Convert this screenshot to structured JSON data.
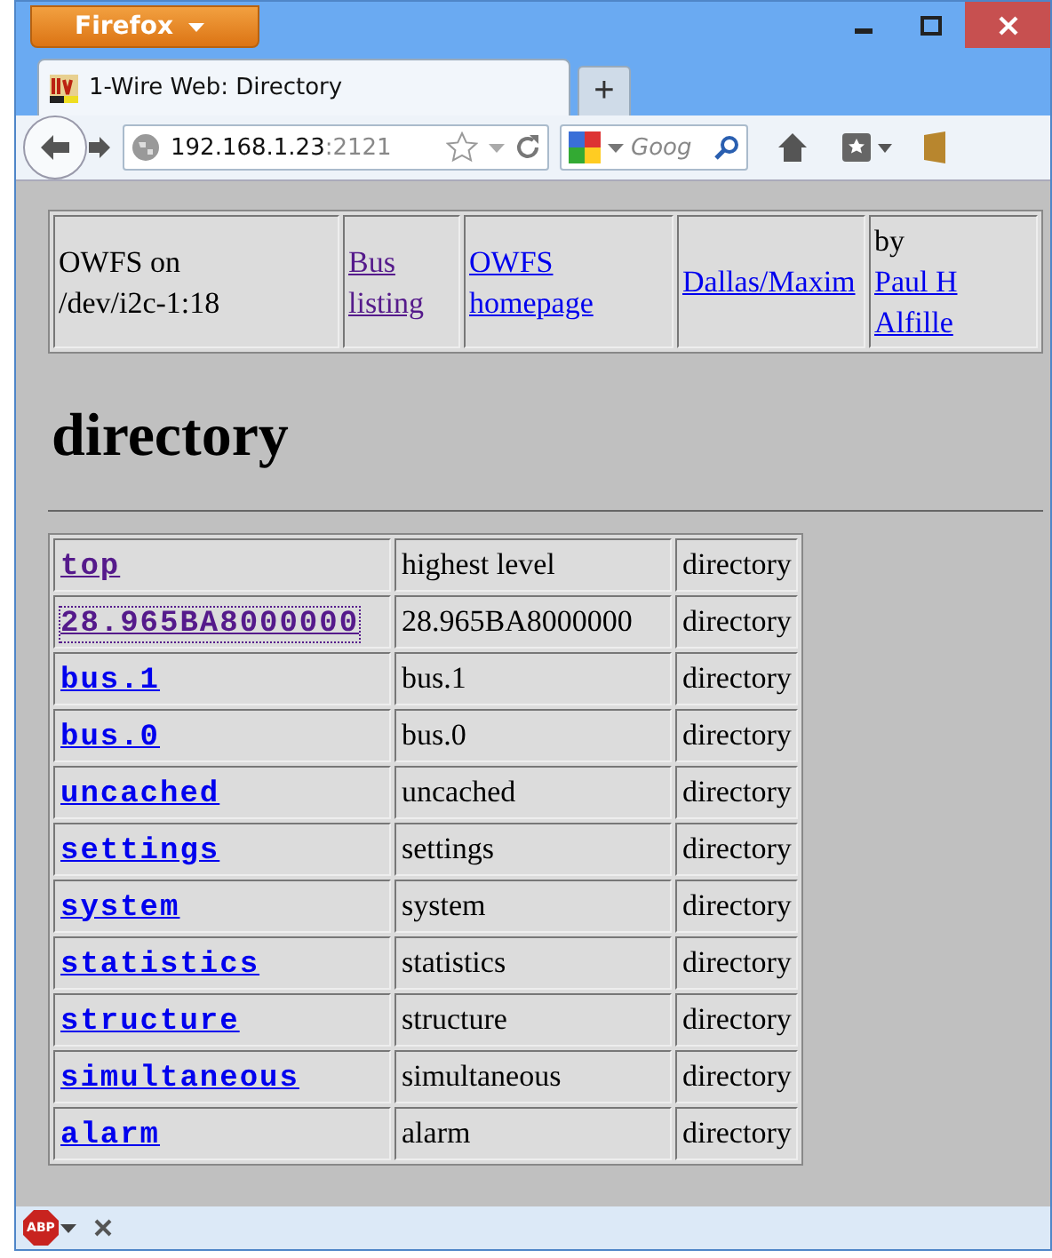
{
  "browser": {
    "menu_button": "Firefox",
    "tabs": [
      {
        "title": "1-Wire Web: Directory",
        "selected": true
      }
    ],
    "new_tab": "+",
    "address": {
      "host": "192.168.1.23",
      "port": ":2121"
    },
    "search": {
      "placeholder": "Goog"
    }
  },
  "header": [
    {
      "text": "OWFS on /dev/i2c-1:18"
    },
    {
      "link": "Bus listing",
      "visited": true
    },
    {
      "link": "OWFS homepage",
      "visited": false
    },
    {
      "link": "Dallas/Maxim",
      "visited": false
    },
    {
      "text": "by ",
      "link": "Paul H Alfille",
      "visited": false
    }
  ],
  "heading": "directory",
  "rows": [
    {
      "name": "top",
      "visited": true,
      "focused": false,
      "description": "highest level",
      "type": "directory"
    },
    {
      "name": "28.965BA8000000",
      "visited": true,
      "focused": true,
      "description": "28.965BA8000000",
      "type": "directory"
    },
    {
      "name": "bus.1",
      "visited": false,
      "focused": false,
      "description": "bus.1",
      "type": "directory"
    },
    {
      "name": "bus.0",
      "visited": false,
      "focused": false,
      "description": "bus.0",
      "type": "directory"
    },
    {
      "name": "uncached",
      "visited": false,
      "focused": false,
      "description": "uncached",
      "type": "directory"
    },
    {
      "name": "settings",
      "visited": false,
      "focused": false,
      "description": "settings",
      "type": "directory"
    },
    {
      "name": "system",
      "visited": false,
      "focused": false,
      "description": "system",
      "type": "directory"
    },
    {
      "name": "statistics",
      "visited": false,
      "focused": false,
      "description": "statistics",
      "type": "directory"
    },
    {
      "name": "structure",
      "visited": false,
      "focused": false,
      "description": "structure",
      "type": "directory"
    },
    {
      "name": "simultaneous",
      "visited": false,
      "focused": false,
      "description": "simultaneous",
      "type": "directory"
    },
    {
      "name": "alarm",
      "visited": false,
      "focused": false,
      "description": "alarm",
      "type": "directory"
    }
  ],
  "addon_bar": {
    "addon_label": "ABP"
  }
}
